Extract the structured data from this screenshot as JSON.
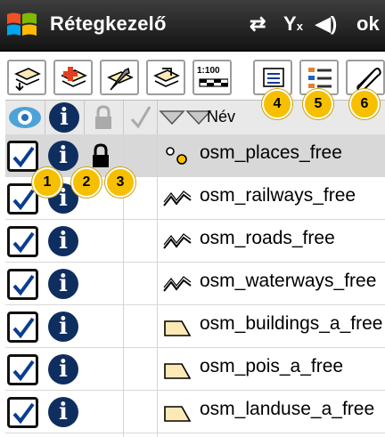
{
  "window": {
    "title": "Rétegkezelő",
    "ok_label": "ok"
  },
  "toolbar": {
    "buttons": [
      {
        "name": "layer-open",
        "icon": "layer-arrow-icon"
      },
      {
        "name": "layer-add",
        "icon": "layer-plus-icon"
      },
      {
        "name": "layer-edit",
        "icon": "wrench-icon"
      },
      {
        "name": "layer-export",
        "icon": "layer-export-icon"
      },
      {
        "name": "scale",
        "icon": "scale-icon",
        "label": "1:100"
      },
      {
        "name": "properties",
        "icon": "properties-icon"
      },
      {
        "name": "legend",
        "icon": "legend-list-icon"
      },
      {
        "name": "attach",
        "icon": "paperclip-icon"
      }
    ]
  },
  "table": {
    "name_header": "Név"
  },
  "layers": [
    {
      "name": "osm_places_free",
      "geometry": "point",
      "visible": true,
      "locked": true,
      "selected": true
    },
    {
      "name": "osm_railways_free",
      "geometry": "line",
      "visible": true,
      "locked": false,
      "selected": false
    },
    {
      "name": "osm_roads_free",
      "geometry": "line",
      "visible": true,
      "locked": false,
      "selected": false
    },
    {
      "name": "osm_waterways_free",
      "geometry": "line",
      "visible": true,
      "locked": false,
      "selected": false
    },
    {
      "name": "osm_buildings_a_free",
      "geometry": "polygon",
      "visible": true,
      "locked": false,
      "selected": false
    },
    {
      "name": "osm_pois_a_free",
      "geometry": "polygon",
      "visible": true,
      "locked": false,
      "selected": false
    },
    {
      "name": "osm_landuse_a_free",
      "geometry": "polygon",
      "visible": true,
      "locked": false,
      "selected": false
    }
  ],
  "callouts": [
    "1",
    "2",
    "3",
    "4",
    "5",
    "6"
  ],
  "colors": {
    "badge": "#f6c000",
    "info": "#0f2e60",
    "selected_row": "#d8d8d8",
    "polygon_fill": "#fde9b5",
    "point_fill": "#f6c000"
  }
}
